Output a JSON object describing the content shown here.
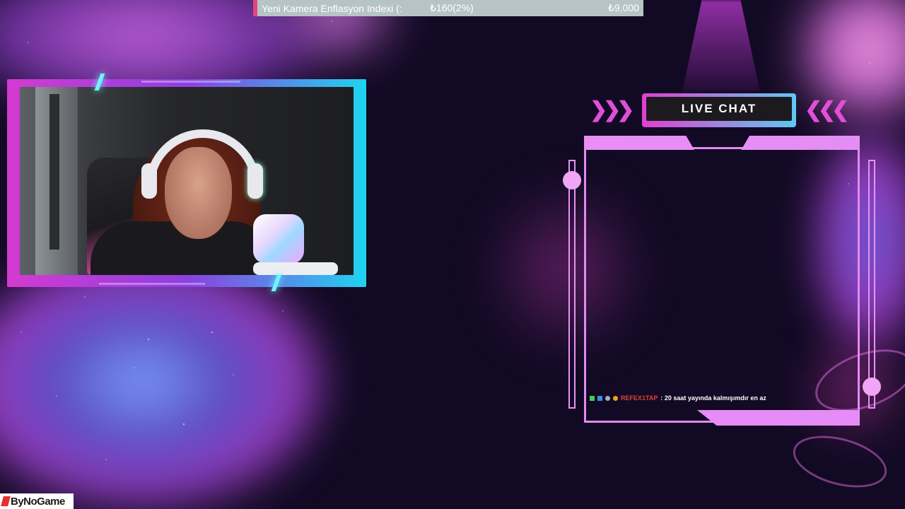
{
  "ticker": {
    "name": "Yeni Kamera Enflasyon Indexi (:",
    "change": "₺160(2%)",
    "price": "₺9,000"
  },
  "chat": {
    "title": "LIVE CHAT",
    "messages": [
      {
        "badges": [
          "subscriber-badge",
          "verified-badge",
          "moon-badge",
          "coin-badge"
        ],
        "user": "REFEX1TAP",
        "text": ": 20 saat yayında kalmışımdır en az"
      }
    ]
  },
  "watermark": {
    "brand": "ByNoGame"
  },
  "colors": {
    "accent_pink": "#e18bf0",
    "accent_cyan": "#5ec8f0",
    "ticker_bg": "#b7c4c6",
    "username_red": "#e04040"
  }
}
